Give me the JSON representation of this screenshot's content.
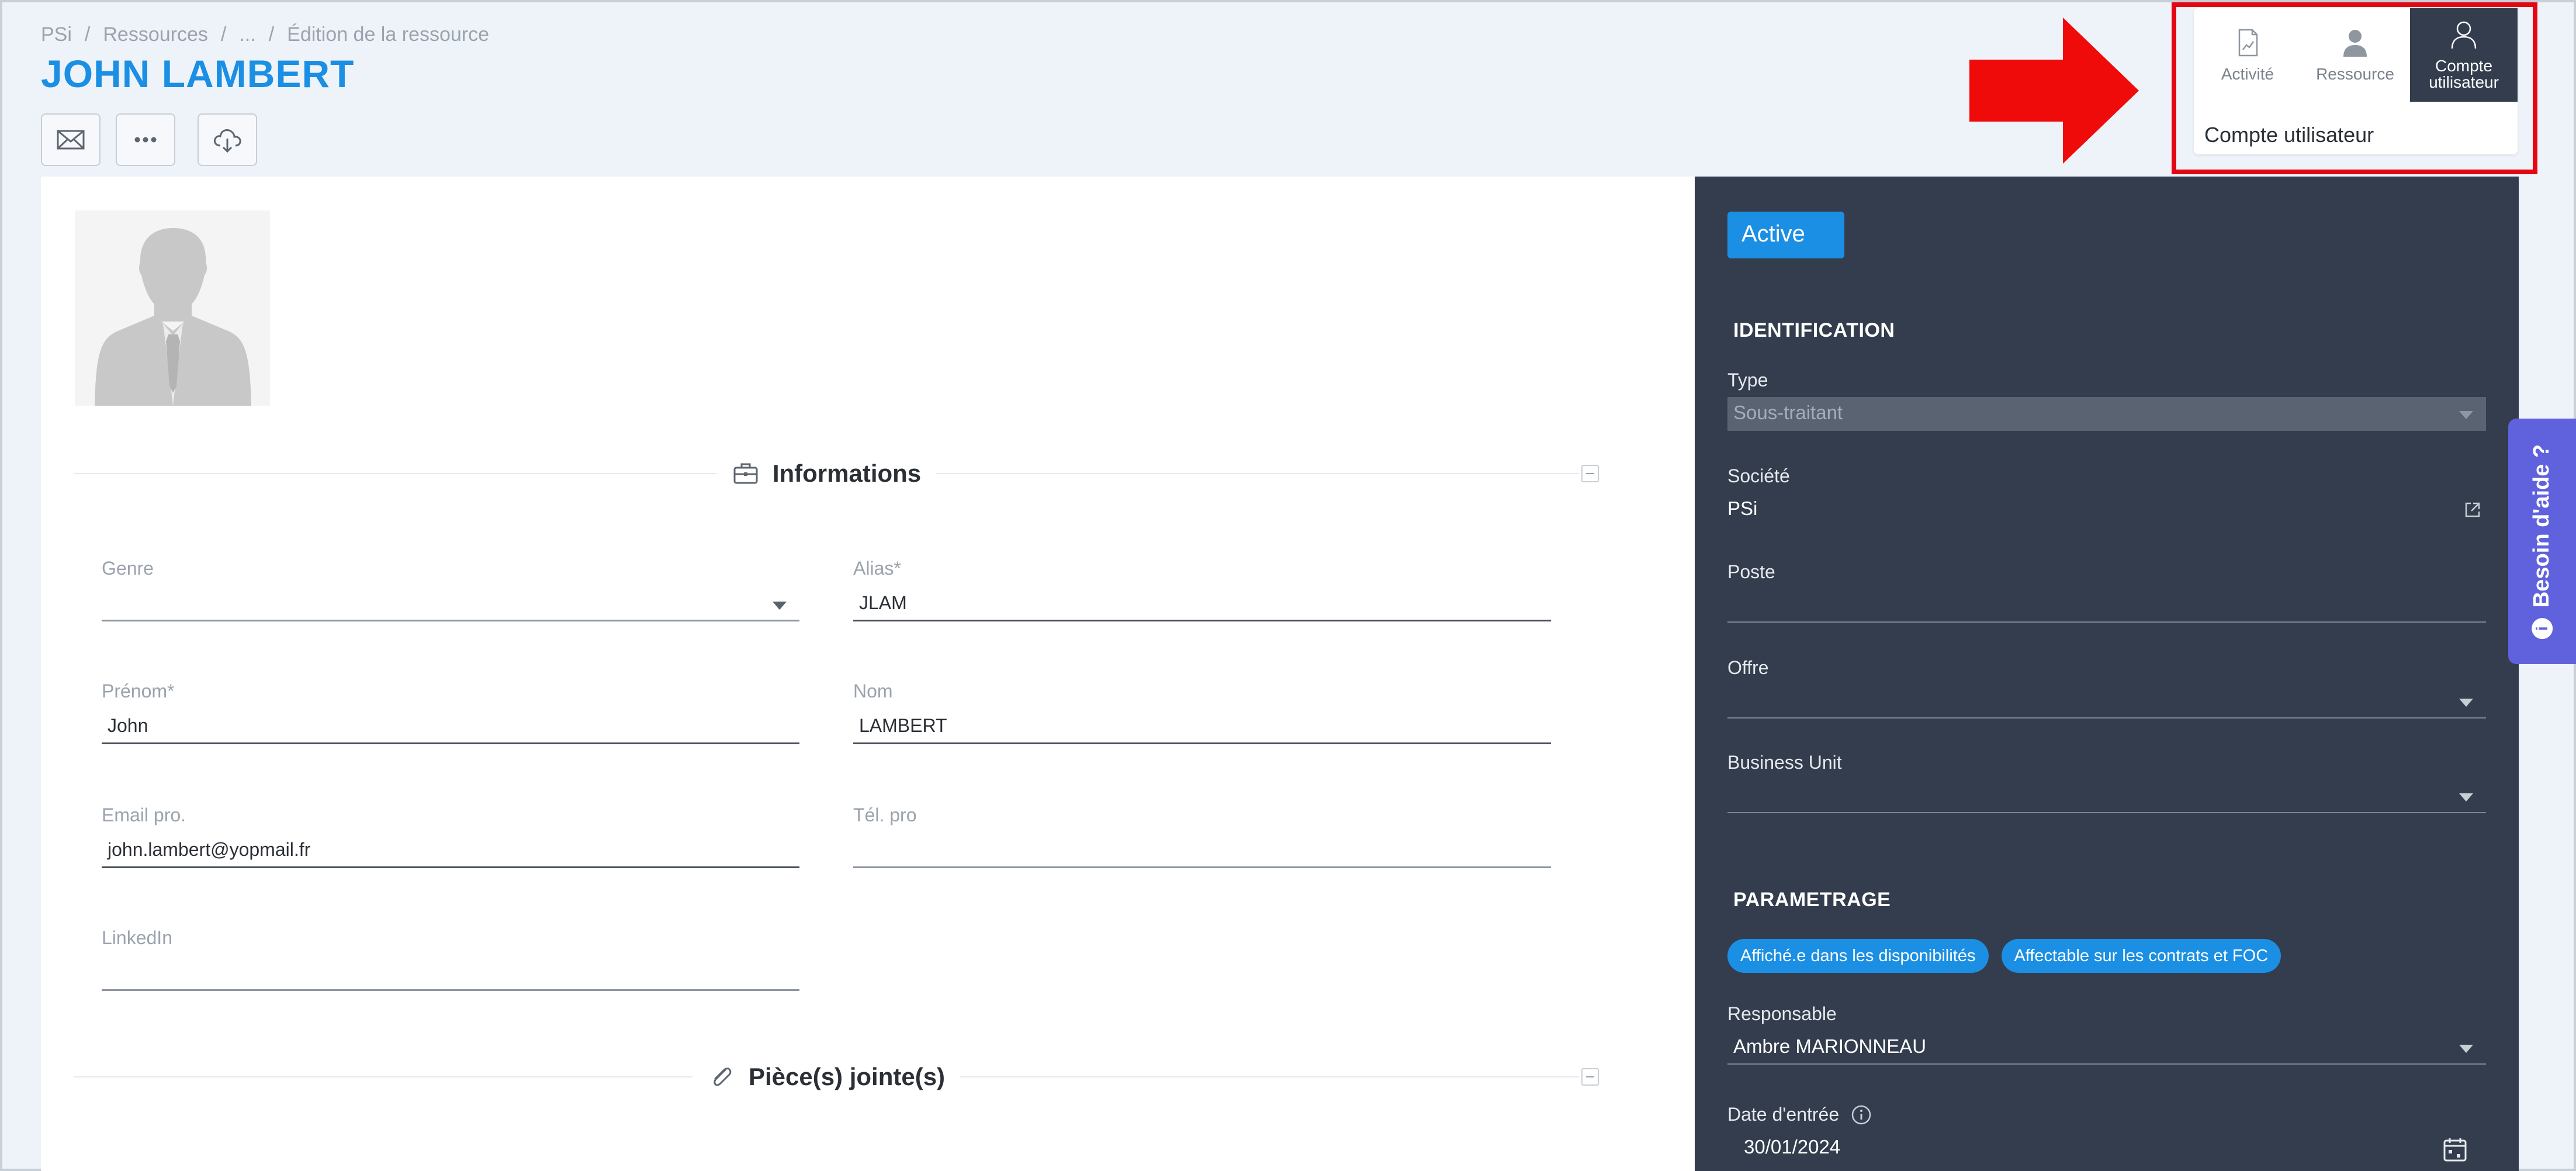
{
  "breadcrumb": [
    "PSi",
    "/",
    "Ressources",
    "/",
    "...",
    "/",
    "Édition de la ressource"
  ],
  "page_title": "JOHN LAMBERT",
  "toolbar": {
    "icons": [
      "mail-icon",
      "more-icon",
      "cloud-download-icon"
    ]
  },
  "tabs": [
    {
      "label": "Activité",
      "icon": "activity-chart-icon",
      "active": false
    },
    {
      "label": "Ressource",
      "icon": "resource-person-icon",
      "active": false
    },
    {
      "label": "Compte utilisateur",
      "icon": "user-account-icon",
      "active": true
    }
  ],
  "tab_caption": "Compte utilisateur",
  "sections": {
    "informations": "Informations",
    "attachments": "Pièce(s) jointe(s)"
  },
  "form": {
    "genre": {
      "label": "Genre",
      "value": ""
    },
    "alias": {
      "label": "Alias*",
      "value": "JLAM"
    },
    "prenom": {
      "label": "Prénom*",
      "value": "John"
    },
    "nom": {
      "label": "Nom",
      "value": "LAMBERT"
    },
    "email": {
      "label": "Email pro.",
      "value": "john.lambert@yopmail.fr"
    },
    "tel": {
      "label": "Tél. pro",
      "value": ""
    },
    "linkedin": {
      "label": "LinkedIn",
      "value": ""
    }
  },
  "panel": {
    "status": "Active",
    "identification": "IDENTIFICATION",
    "type": {
      "label": "Type",
      "value": "Sous-traitant"
    },
    "societe": {
      "label": "Société",
      "value": "PSi"
    },
    "poste": {
      "label": "Poste",
      "value": ""
    },
    "offre": {
      "label": "Offre",
      "value": ""
    },
    "bu": {
      "label": "Business Unit",
      "value": ""
    },
    "parametrage": "PARAMETRAGE",
    "chips": [
      "Affiché.e dans les disponibilités",
      "Affectable sur les contrats et FOC"
    ],
    "responsable": {
      "label": "Responsable",
      "value": "Ambre MARIONNEAU"
    },
    "date_entree": {
      "label": "Date d'entrée",
      "value": "30/01/2024"
    }
  },
  "help": {
    "label": "Besoin d'aide ?"
  },
  "colors": {
    "accent": "#1b8fe3",
    "panel": "#333d4d",
    "help": "#5f62dc",
    "highlight": "#e30613"
  }
}
